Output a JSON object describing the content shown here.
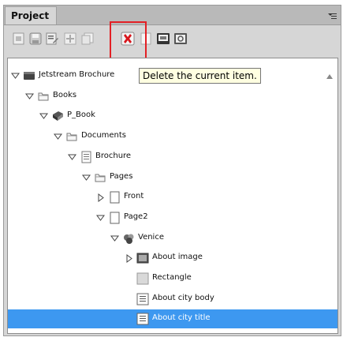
{
  "panel": {
    "tab_label": "Project",
    "menu_icon": "panel-menu-icon"
  },
  "toolbar": {
    "buttons": [
      {
        "name": "new-item-button",
        "icon": "page-icon"
      },
      {
        "name": "save-button",
        "icon": "disk-icon"
      },
      {
        "name": "properties-button",
        "icon": "list-edit-icon"
      },
      {
        "name": "add-button",
        "icon": "plus-icon"
      },
      {
        "name": "copy-button",
        "icon": "copy-icon"
      },
      {
        "name": "delete-button",
        "icon": "red-x-icon"
      },
      {
        "name": "page-button",
        "icon": "blank-page-icon"
      },
      {
        "name": "preview-button",
        "icon": "screen-icon"
      },
      {
        "name": "export-button",
        "icon": "export-icon"
      }
    ],
    "highlight_color": "#e32025"
  },
  "tooltip": {
    "text": "Delete the current item."
  },
  "tree": {
    "selection_color": "#3d98f0",
    "items": [
      {
        "label": "Jetstream Brochure",
        "icon": "project-icon",
        "expander": "expanded",
        "depth": 0
      },
      {
        "label": "Books",
        "icon": "folder-icon",
        "expander": "expanded",
        "depth": 1
      },
      {
        "label": "P_Book",
        "icon": "book-icon",
        "expander": "expanded",
        "depth": 2
      },
      {
        "label": "Documents",
        "icon": "folder-icon",
        "expander": "expanded",
        "depth": 3
      },
      {
        "label": "Brochure",
        "icon": "document-icon",
        "expander": "expanded",
        "depth": 4
      },
      {
        "label": "Pages",
        "icon": "folder-icon",
        "expander": "expanded",
        "depth": 5
      },
      {
        "label": "Front",
        "icon": "page-icon",
        "expander": "collapsed",
        "depth": 6
      },
      {
        "label": "Page2",
        "icon": "page-icon",
        "expander": "expanded",
        "depth": 6
      },
      {
        "label": "Venice",
        "icon": "group-icon",
        "expander": "expanded",
        "depth": 7
      },
      {
        "label": "About image",
        "icon": "image-icon",
        "expander": "collapsed",
        "depth": 8
      },
      {
        "label": "Rectangle",
        "icon": "rectangle-icon",
        "expander": "none",
        "depth": 8
      },
      {
        "label": "About city body",
        "icon": "text-icon",
        "expander": "none",
        "depth": 8
      },
      {
        "label": "About city title",
        "icon": "text-icon",
        "expander": "none",
        "depth": 8,
        "selected": true
      }
    ]
  }
}
